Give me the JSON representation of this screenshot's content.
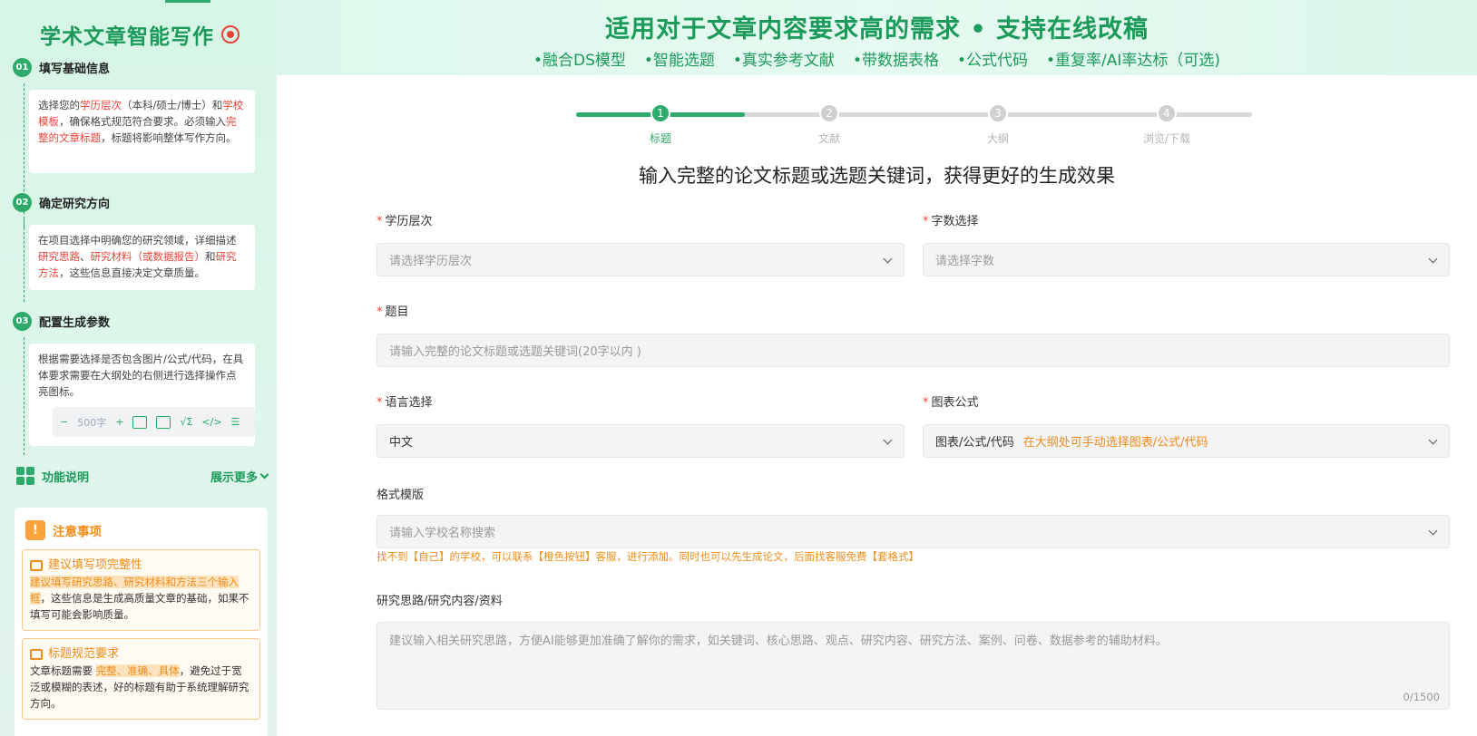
{
  "sidebar": {
    "title": "学术文章智能写作",
    "steps": [
      {
        "num": "01",
        "title": "填写基础信息"
      },
      {
        "num": "02",
        "title": "确定研究方向"
      },
      {
        "num": "03",
        "title": "配置生成参数"
      }
    ],
    "step1_parts": [
      "选择您的",
      "学历层次",
      "（本科/硕士/博士）和",
      "学校模板",
      "，确保格式规范符合要求。必须输入",
      "完整的文章标题",
      "，标题将影响整体写作方向。"
    ],
    "step2_parts": [
      "在项目选择中明确您的研究领域，详细描述",
      "研究思路",
      "、",
      "研究材料（或数据报告）",
      "和",
      "研究方法",
      "，这些信息直接决定文章质量。"
    ],
    "step3_text": "根据需要选择是否包含图片/公式/代码，在具体要求需要在大纲处的右侧进行选择操作点亮图标。",
    "toolbar": {
      "minus": "−",
      "count": "500字",
      "plus": "+"
    },
    "feature_label": "功能说明",
    "more_label": "展示更多",
    "notice_title": "注意事项",
    "tips": [
      {
        "title": "建议填写项完整性",
        "highlight": "建议填写研究思路、研究材料和方法三个输入框",
        "rest": "，这些信息是生成高质量文章的基础，如果不填写可能会影响质量。"
      },
      {
        "title": "标题规范要求",
        "pre": "文章标题需要",
        "highlight": "完整、准确、具体",
        "rest": "，避免过于宽泛或模糊的表述，好的标题有助于系统理解研究方向。"
      }
    ]
  },
  "header": {
    "title": "适用对于文章内容要求高的需求 • 支持在线改稿",
    "features": [
      "•融合DS模型",
      "•智能选题",
      "•真实参考文献",
      "•带数据表格",
      "•公式代码",
      "•重复率/AI率达标（可选)"
    ]
  },
  "stepper": {
    "steps": [
      {
        "num": "1",
        "label": "标题"
      },
      {
        "num": "2",
        "label": "文献"
      },
      {
        "num": "3",
        "label": "大纲"
      },
      {
        "num": "4",
        "label": "浏览/下载"
      }
    ],
    "current": 1
  },
  "main": {
    "heading": "输入完整的论文标题或选题关键词，获得更好的生成效果",
    "education": {
      "label": "学历层次",
      "placeholder": "请选择学历层次"
    },
    "wordcount": {
      "label": "字数选择",
      "placeholder": "请选择字数"
    },
    "topic": {
      "label": "题目",
      "placeholder": "请输入完整的论文标题或选题关键词(20字以内 )"
    },
    "language": {
      "label": "语言选择",
      "value": "中文"
    },
    "charts": {
      "label": "图表公式",
      "value": "图表/公式/代码",
      "hint": "在大纲处可手动选择图表/公式/代码"
    },
    "template": {
      "label": "格式模版",
      "placeholder": "请输入学校名称搜索",
      "note": "找不到【自己】的学校，可以联系【橙色按钮】客服，进行添加。同时也可以先生成论文，后面找客服免费【套格式】"
    },
    "research": {
      "label": "研究思路/研究内容/资料",
      "placeholder": "建议输入相关研究思路，方便AI能够更加准确了解你的需求，如关键词、核心思路、观点、研究内容、研究方法、案例、问卷、数据参考的辅助材料。",
      "counter": "0/1500"
    }
  },
  "colors": {
    "brand": "#2eaa6a",
    "accent_red": "#e8433a",
    "accent_orange": "#f08c1a"
  }
}
